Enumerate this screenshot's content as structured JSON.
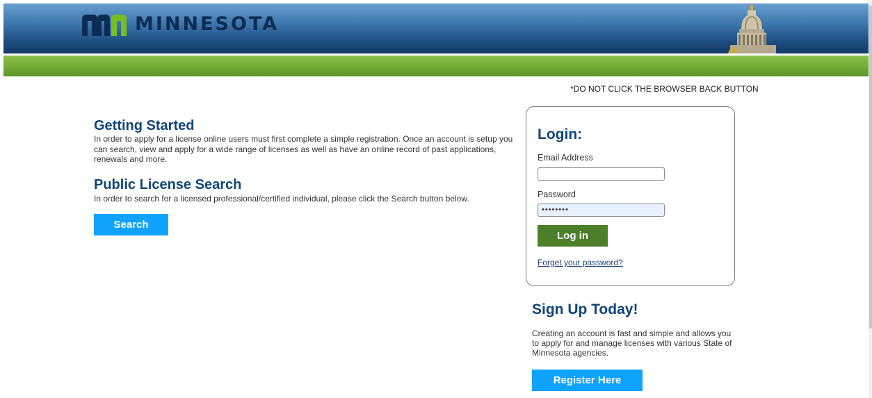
{
  "header": {
    "logo_text": "MINNESOTA",
    "brand_colors": {
      "mn_blue": "#0b2d55",
      "mn_green": "#78be20"
    }
  },
  "notice": "*DO NOT CLICK THE BROWSER BACK BUTTON",
  "getting_started": {
    "title": "Getting Started",
    "text": "In order to apply for a license online users must first complete a simple registration. Once an account is setup you can search, view and apply for a wide range of licenses as well as have an online record of past applications, renewals and more."
  },
  "public_search": {
    "title": "Public License Search",
    "text": "In order to search for a licensed professional/certified individual, please click the Search button below.",
    "button_label": "Search"
  },
  "login": {
    "title": "Login:",
    "email_label": "Email Address",
    "email_value": "",
    "password_label": "Password",
    "password_value": "••••••••",
    "button_label": "Log in",
    "forgot_link": "Forget your password?"
  },
  "signup": {
    "title": "Sign Up Today!",
    "text": "Creating an account is fast and simple and allows you to apply for and manage licenses with various State of Minnesota agencies.",
    "button_label": "Register Here"
  }
}
